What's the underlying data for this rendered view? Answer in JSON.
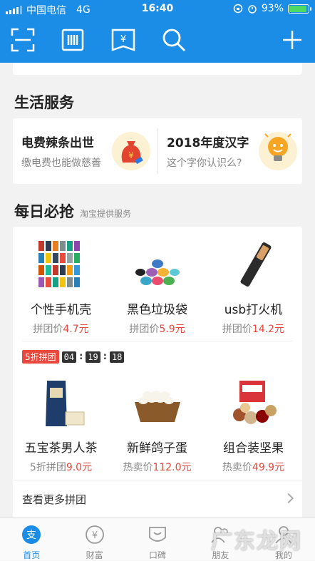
{
  "status_bar": {
    "carrier": "中国电信",
    "network": "4G",
    "time": "16:40",
    "battery_percent": "93%",
    "battery_level": 0.93
  },
  "toolbar": {
    "icons": [
      "scan-icon",
      "pay-code-icon",
      "card-icon",
      "search-icon",
      "add-icon"
    ]
  },
  "life_services": {
    "title": "生活服务",
    "items": [
      {
        "title": "电费辣条出世",
        "subtitle": "缴电费也能做慈善"
      },
      {
        "title": "2018年度汉字",
        "subtitle": "这个字你认识么?"
      }
    ]
  },
  "daily_deals": {
    "title": "每日必抢",
    "subtitle": "淘宝提供服务",
    "row1": [
      {
        "name": "个性手机壳",
        "price_label": "拼团价",
        "price": "4.7元"
      },
      {
        "name": "黑色垃圾袋",
        "price_label": "拼团价",
        "price": "5.9元"
      },
      {
        "name": "usb打火机",
        "price_label": "拼团价",
        "price": "14.2元"
      }
    ],
    "flash_sale": {
      "badge": "5折拼团",
      "hours": "04",
      "minutes": "19",
      "seconds": "18"
    },
    "row2": [
      {
        "name": "五宝茶男人茶",
        "price_label": "5折拼团",
        "price": "9.0元"
      },
      {
        "name": "新鲜鸽子蛋",
        "price_label": "热卖价",
        "price": "112.0元"
      },
      {
        "name": "组合装坚果",
        "price_label": "热卖价",
        "price": "49.9元"
      }
    ],
    "more_link": "查看更多拼团"
  },
  "tabbar": {
    "tabs": [
      {
        "label": "首页",
        "active": true
      },
      {
        "label": "财富",
        "active": false
      },
      {
        "label": "口碑",
        "active": false
      },
      {
        "label": "朋友",
        "active": false
      },
      {
        "label": "我的",
        "active": false
      }
    ]
  },
  "watermark": "广东龙网",
  "colors": {
    "brand_blue": "#1b8de6",
    "price_red": "#e8483d",
    "background": "#f2f2f2"
  }
}
